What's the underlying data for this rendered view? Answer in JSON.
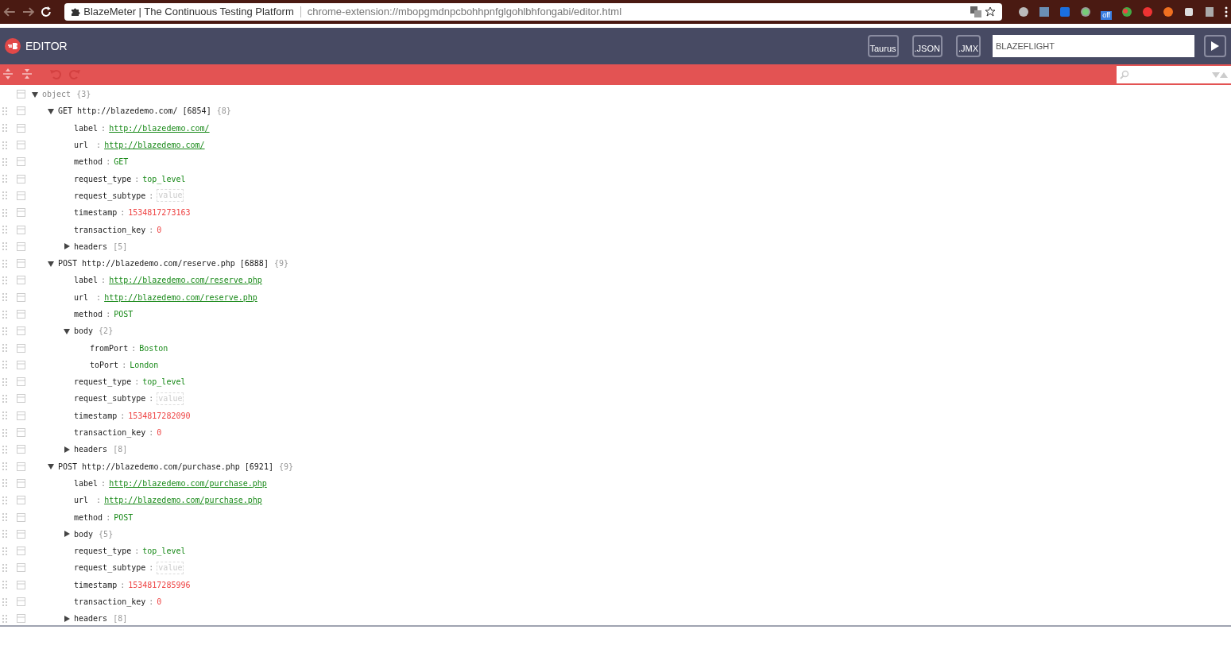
{
  "browser": {
    "page_title": "BlazeMeter | The Continuous Testing Platform",
    "url": "chrome-extension://mbopgmdnpcbohhpnfglgohlbhfongabi/editor.html",
    "extension_badge": "off"
  },
  "header": {
    "title": "EDITOR",
    "buttons": [
      "Taurus",
      ".JSON",
      ".JMX"
    ],
    "test_name": "BLAZEFLIGHT"
  },
  "toolbar": {
    "undo_disabled": true,
    "redo_disabled": true
  },
  "tree": {
    "kind": "group",
    "key": "object",
    "count": "{3}",
    "expanded": true,
    "children": [
      {
        "kind": "group",
        "key": "GET http://blazedemo.com/ [6854]",
        "count": "{8}",
        "expanded": true,
        "children": [
          {
            "kind": "link",
            "key": "label",
            "separator": ":",
            "value": "http://blazedemo.com/"
          },
          {
            "kind": "link",
            "key": "url ",
            "separator": ":",
            "value": "http://blazedemo.com/"
          },
          {
            "kind": "string",
            "key": "method",
            "separator": ":",
            "value": "GET"
          },
          {
            "kind": "string",
            "key": "request_type",
            "separator": ":",
            "value": "top_level"
          },
          {
            "kind": "empty",
            "key": "request_subtype",
            "separator": ":",
            "placeholder": "value"
          },
          {
            "kind": "number",
            "key": "timestamp",
            "separator": ":",
            "value": "1534817273163"
          },
          {
            "kind": "number",
            "key": "transaction_key",
            "separator": ":",
            "value": "0"
          },
          {
            "kind": "group",
            "key": "headers",
            "count": "[5]",
            "expanded": false
          }
        ]
      },
      {
        "kind": "group",
        "key": "POST http://blazedemo.com/reserve.php [6888]",
        "count": "{9}",
        "expanded": true,
        "children": [
          {
            "kind": "link",
            "key": "label",
            "separator": ":",
            "value": "http://blazedemo.com/reserve.php"
          },
          {
            "kind": "link",
            "key": "url ",
            "separator": ":",
            "value": "http://blazedemo.com/reserve.php"
          },
          {
            "kind": "string",
            "key": "method",
            "separator": ":",
            "value": "POST"
          },
          {
            "kind": "group",
            "key": "body",
            "count": "{2}",
            "expanded": true,
            "children": [
              {
                "kind": "string",
                "key": "fromPort",
                "separator": ":",
                "value": "Boston"
              },
              {
                "kind": "string",
                "key": "toPort",
                "separator": ":",
                "value": "London"
              }
            ]
          },
          {
            "kind": "string",
            "key": "request_type",
            "separator": ":",
            "value": "top_level"
          },
          {
            "kind": "empty",
            "key": "request_subtype",
            "separator": ":",
            "placeholder": "value"
          },
          {
            "kind": "number",
            "key": "timestamp",
            "separator": ":",
            "value": "1534817282090"
          },
          {
            "kind": "number",
            "key": "transaction_key",
            "separator": ":",
            "value": "0"
          },
          {
            "kind": "group",
            "key": "headers",
            "count": "[8]",
            "expanded": false
          }
        ]
      },
      {
        "kind": "group",
        "key": "POST http://blazedemo.com/purchase.php [6921]",
        "count": "{9}",
        "expanded": true,
        "children": [
          {
            "kind": "link",
            "key": "label",
            "separator": ":",
            "value": "http://blazedemo.com/purchase.php"
          },
          {
            "kind": "link",
            "key": "url ",
            "separator": ":",
            "value": "http://blazedemo.com/purchase.php"
          },
          {
            "kind": "string",
            "key": "method",
            "separator": ":",
            "value": "POST"
          },
          {
            "kind": "group",
            "key": "body",
            "count": "{5}",
            "expanded": false
          },
          {
            "kind": "string",
            "key": "request_type",
            "separator": ":",
            "value": "top_level"
          },
          {
            "kind": "empty",
            "key": "request_subtype",
            "separator": ":",
            "placeholder": "value"
          },
          {
            "kind": "number",
            "key": "timestamp",
            "separator": ":",
            "value": "1534817285996"
          },
          {
            "kind": "number",
            "key": "transaction_key",
            "separator": ":",
            "value": "0"
          },
          {
            "kind": "group",
            "key": "headers",
            "count": "[8]",
            "expanded": false
          }
        ]
      }
    ]
  }
}
